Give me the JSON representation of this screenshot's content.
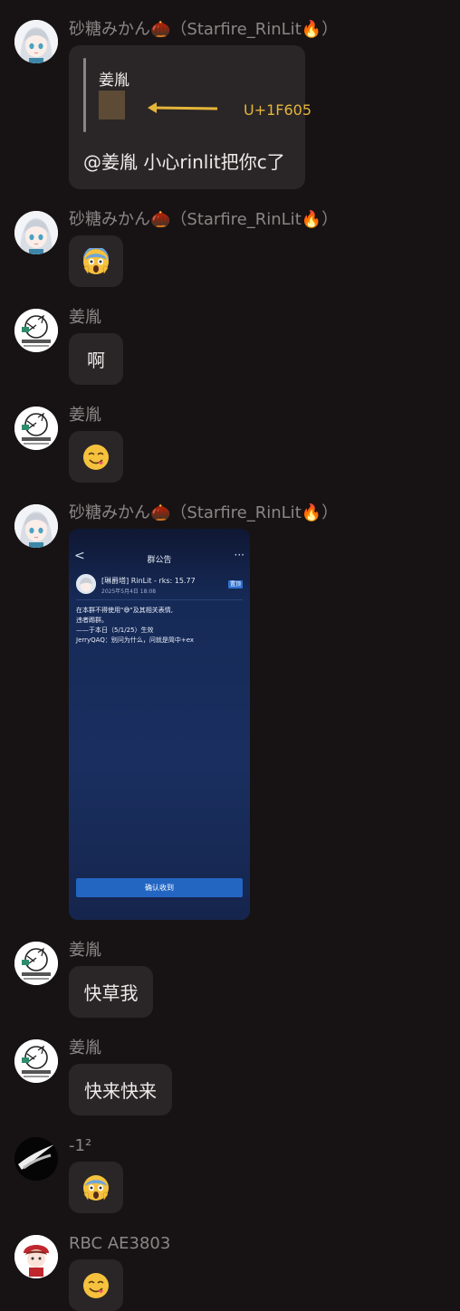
{
  "messages": [
    {
      "sender": "砂糖みかん🌰（Starfire_RinLit🔥）",
      "quote": {
        "author": "姜胤",
        "annotation": "U+1F605",
        "reply": "@姜胤 小心rinlit把你c了"
      }
    },
    {
      "sender": "砂糖みかん🌰（Starfire_RinLit🔥）",
      "emoji": "face-screaming-in-fear"
    },
    {
      "sender": "姜胤",
      "text": "啊"
    },
    {
      "sender": "姜胤",
      "emoji": "face-savoring-food"
    },
    {
      "sender": "砂糖みかん🌰（Starfire_RinLit🔥）",
      "screenshot": {
        "title": "群公告",
        "back_glyph": "<",
        "more_glyph": "···",
        "poster": "[琳爵塔] RinLit - rks: 15.77",
        "date": "2025年5月4日 18:08",
        "pin_label": "置顶",
        "lines": [
          "在本群不得使用\"😅\"及其相关表情,",
          "违者踢群。",
          "——于本日（5/1/25）生效",
          "JerryQAQ：别问为什么，问就是简中+ex"
        ],
        "confirm_label": "确认收到"
      }
    },
    {
      "sender": "姜胤",
      "text": "快草我"
    },
    {
      "sender": "姜胤",
      "text": "快来快来"
    },
    {
      "sender": "-1²",
      "emoji": "face-screaming-in-fear"
    },
    {
      "sender": "RBC AE3803",
      "emoji": "face-savoring-food"
    }
  ],
  "colors": {
    "background": "#171314",
    "bubble": "#2a2627",
    "sender_name": "#8b8686",
    "annotation": "#e5b53a"
  }
}
